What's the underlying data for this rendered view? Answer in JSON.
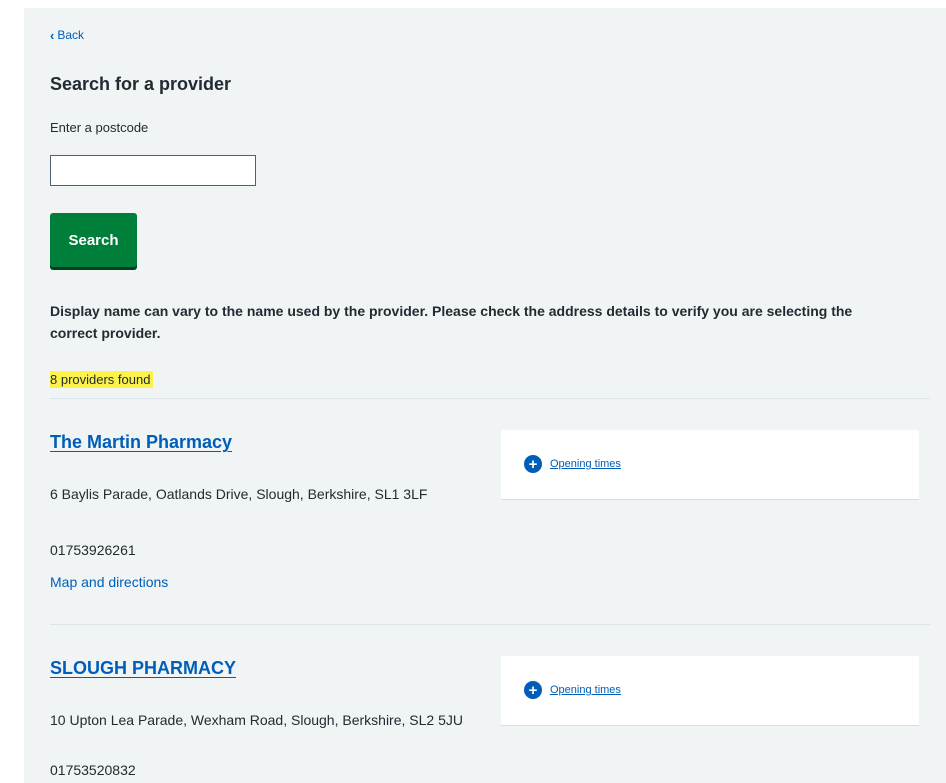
{
  "nav": {
    "back_label": "Back"
  },
  "search": {
    "title": "Search for a provider",
    "field_label": "Enter a postcode",
    "input_value": "",
    "button_label": "Search"
  },
  "disclaimer": "Display name can vary to the name used by the provider. Please check the address details to verify you are selecting the correct provider.",
  "results": {
    "count_text": "8 providers found",
    "providers": [
      {
        "name": "The Martin Pharmacy",
        "address": "6 Baylis Parade, Oatlands Drive, Slough, Berkshire, SL1 3LF",
        "phone": "01753926261",
        "map_link": "Map and directions",
        "opening_times_label": "Opening times"
      },
      {
        "name": "SLOUGH PHARMACY",
        "address": "10 Upton Lea Parade, Wexham Road, Slough, Berkshire, SL2 5JU",
        "phone": "01753520832",
        "opening_times_label": "Opening times"
      }
    ]
  },
  "colors": {
    "panel_background": "#f0f4f5",
    "link": "#005eb8",
    "button": "#007f3b",
    "highlight": "#fdf24a"
  }
}
